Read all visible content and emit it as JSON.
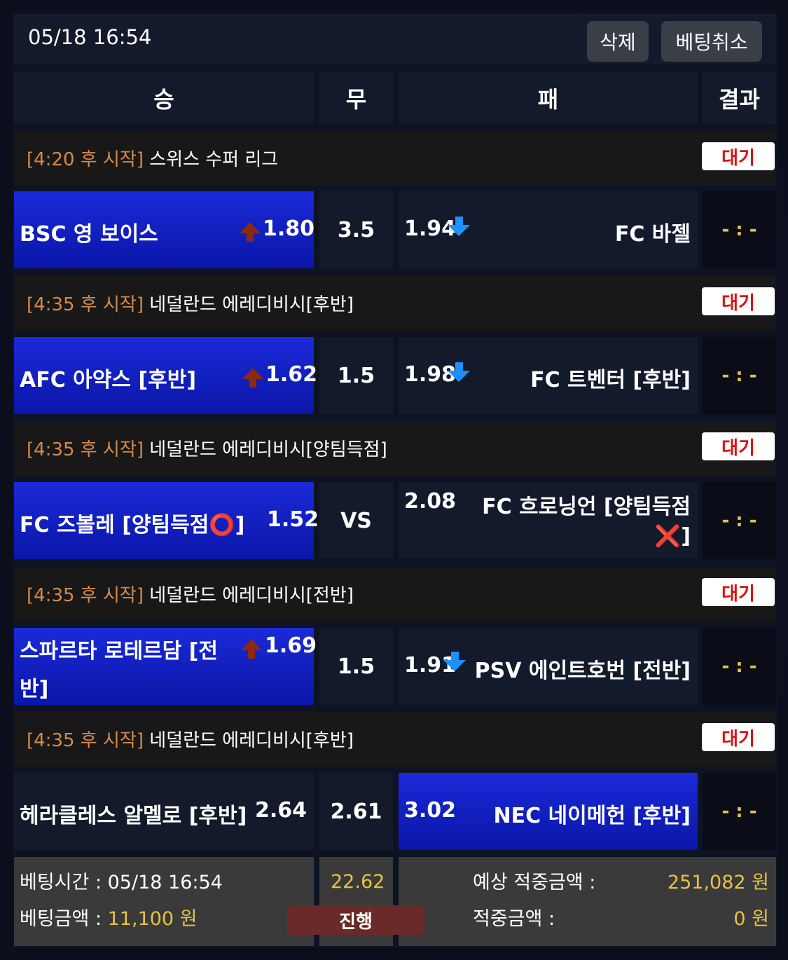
{
  "header": {
    "datetime": "05/18 16:54",
    "delete_label": "삭제",
    "cancel_label": "베팅취소"
  },
  "columns": {
    "win": "승",
    "draw": "무",
    "lose": "패",
    "result": "결과"
  },
  "matches": [
    {
      "time": "[4:20 후 시작]",
      "league": "스위스 수퍼 리그",
      "status": "대기",
      "home": "BSC 영 보이스",
      "home_odd": "1.80",
      "draw": "3.5",
      "away_odd": "1.94",
      "away": "FC 바젤",
      "result": "- : -",
      "selected": "home"
    },
    {
      "time": "[4:35 후 시작]",
      "league": "네덜란드 에레디비시[후반]",
      "status": "대기",
      "home": "AFC 아약스 [후반]",
      "home_odd": "1.62",
      "draw": "1.5",
      "away_odd": "1.98",
      "away": "FC 트벤터 [후반]",
      "result": "- : -",
      "selected": "home"
    },
    {
      "time": "[4:35 후 시작]",
      "league": "네덜란드 에레디비시[양팀득점]",
      "status": "대기",
      "home": "FC 즈볼레 [양팀득점⭕]",
      "home_odd": "1.52",
      "draw": "VS",
      "away_odd": "2.08",
      "away": "FC 흐로닝언 [양팀득점",
      "away2": "❌]",
      "result": "- : -",
      "selected": "home"
    },
    {
      "time": "[4:35 후 시작]",
      "league": "네덜란드 에레디비시[전반]",
      "status": "대기",
      "home": "스파르타 로테르담 [전",
      "home2": "반]",
      "home_odd": "1.69",
      "draw": "1.5",
      "away_odd": "1.91",
      "away": "PSV 에인트호번 [전반]",
      "result": "- : -",
      "selected": "home"
    },
    {
      "time": "[4:35 후 시작]",
      "league": "네덜란드 에레디비시[후반]",
      "status": "대기",
      "home": "헤라클레스 알멜로 [후반]",
      "home_odd": "2.64",
      "draw": "2.61",
      "away_odd": "3.02",
      "away": "NEC 네이메헌 [후반]",
      "result": "- : -",
      "selected": "away"
    }
  ],
  "footer": {
    "bet_time_label": "베팅시간 : ",
    "bet_time": "05/18 16:54",
    "bet_amount_label": "베팅금액 : ",
    "bet_amount": "11,100 원",
    "total_odds": "22.62",
    "progress": "진행",
    "expected_label": "예상 적중금액 :",
    "expected_value": "251,082 원",
    "hit_label": "적중금액 :",
    "hit_value": "0 원"
  },
  "colors": {
    "selected": "#1a2ad8",
    "gold": "#e7c242",
    "time": "#d68a4a",
    "badge_text": "#d11111"
  }
}
